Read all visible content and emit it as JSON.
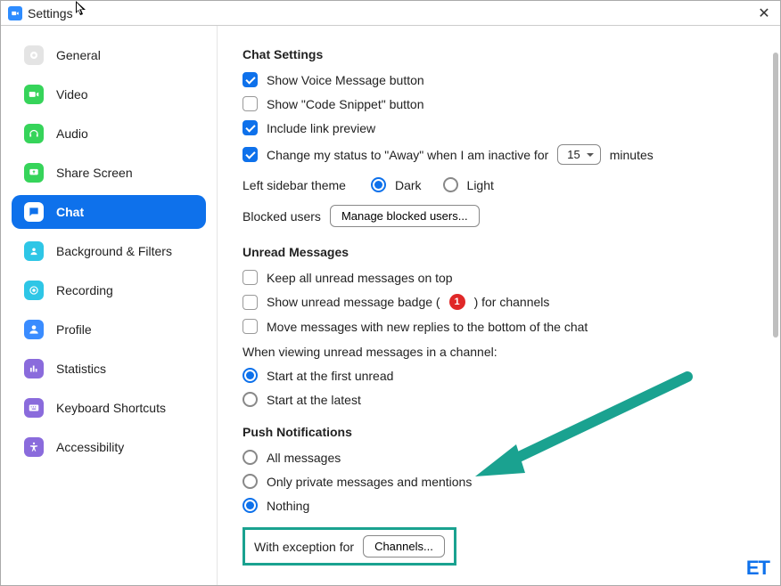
{
  "window": {
    "title": "Settings"
  },
  "nav": {
    "items": [
      {
        "key": "general",
        "label": "General"
      },
      {
        "key": "video",
        "label": "Video"
      },
      {
        "key": "audio",
        "label": "Audio"
      },
      {
        "key": "share-screen",
        "label": "Share Screen"
      },
      {
        "key": "chat",
        "label": "Chat"
      },
      {
        "key": "background-filters",
        "label": "Background & Filters"
      },
      {
        "key": "recording",
        "label": "Recording"
      },
      {
        "key": "profile",
        "label": "Profile"
      },
      {
        "key": "statistics",
        "label": "Statistics"
      },
      {
        "key": "keyboard-shortcuts",
        "label": "Keyboard Shortcuts"
      },
      {
        "key": "accessibility",
        "label": "Accessibility"
      }
    ],
    "active": "chat"
  },
  "chatSettings": {
    "heading": "Chat Settings",
    "voiceMessage": {
      "label": "Show Voice Message button",
      "checked": true
    },
    "codeSnippet": {
      "label": "Show \"Code Snippet\" button",
      "checked": false
    },
    "linkPreview": {
      "label": "Include link preview",
      "checked": true
    },
    "awayStatus": {
      "prefix": "Change my status to \"Away\" when I am inactive for",
      "value": "15",
      "suffix": "minutes",
      "checked": true
    },
    "sidebarTheme": {
      "label": "Left sidebar theme",
      "dark": "Dark",
      "light": "Light",
      "selected": "dark"
    },
    "blockedUsers": {
      "label": "Blocked users",
      "button": "Manage blocked users..."
    }
  },
  "unread": {
    "heading": "Unread Messages",
    "keepOnTop": {
      "label": "Keep all unread messages on top",
      "checked": false
    },
    "showBadge": {
      "prefix": "Show unread message badge (",
      "badge": "1",
      "suffix": ") for channels",
      "checked": false
    },
    "moveNewReplies": {
      "label": "Move messages with new replies to the bottom of the chat",
      "checked": false
    },
    "viewingLabel": "When viewing unread messages in a channel:",
    "startFirst": "Start at the first unread",
    "startLatest": "Start at the latest",
    "selected": "first"
  },
  "push": {
    "heading": "Push Notifications",
    "all": "All messages",
    "private": "Only private messages and mentions",
    "nothing": "Nothing",
    "selected": "nothing",
    "exceptionLabel": "With exception for",
    "exceptionButton": "Channels..."
  },
  "watermark": "ET"
}
